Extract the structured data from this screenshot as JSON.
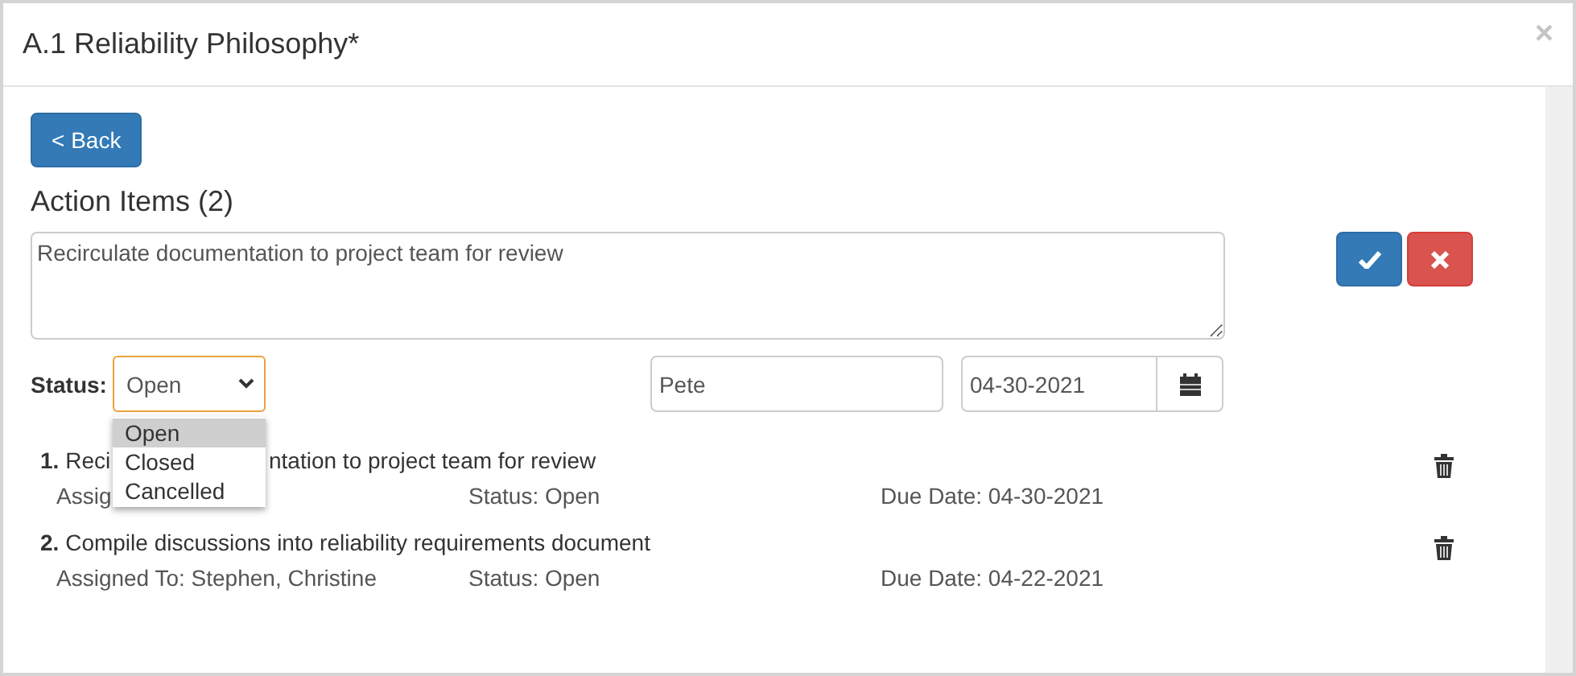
{
  "window": {
    "title": "A.1 Reliability Philosophy*",
    "close": "×"
  },
  "back_button": "< Back",
  "heading": "Action Items (2)",
  "editor": {
    "description": "Recirculate documentation to project team for review",
    "status_label": "Status:",
    "status_value": "Open",
    "status_focused": true,
    "status_options": [
      {
        "label": "Open",
        "selected": true
      },
      {
        "label": "Closed",
        "selected": false
      },
      {
        "label": "Cancelled",
        "selected": false
      }
    ],
    "assignee": "Pete",
    "due_date": "04-30-2021"
  },
  "items": [
    {
      "number": "1.",
      "title_parts": [
        "Reci",
        "ntation to project team for review"
      ],
      "assigned": "Assig",
      "status": "Status: Open",
      "due": "Due Date: 04-30-2021"
    },
    {
      "number": "2.",
      "title_parts": [
        "Compile discussions into reliability requirements document"
      ],
      "assigned": "Assigned To: Stephen, Christine",
      "status": "Status: Open",
      "due": "Due Date: 04-22-2021"
    }
  ]
}
